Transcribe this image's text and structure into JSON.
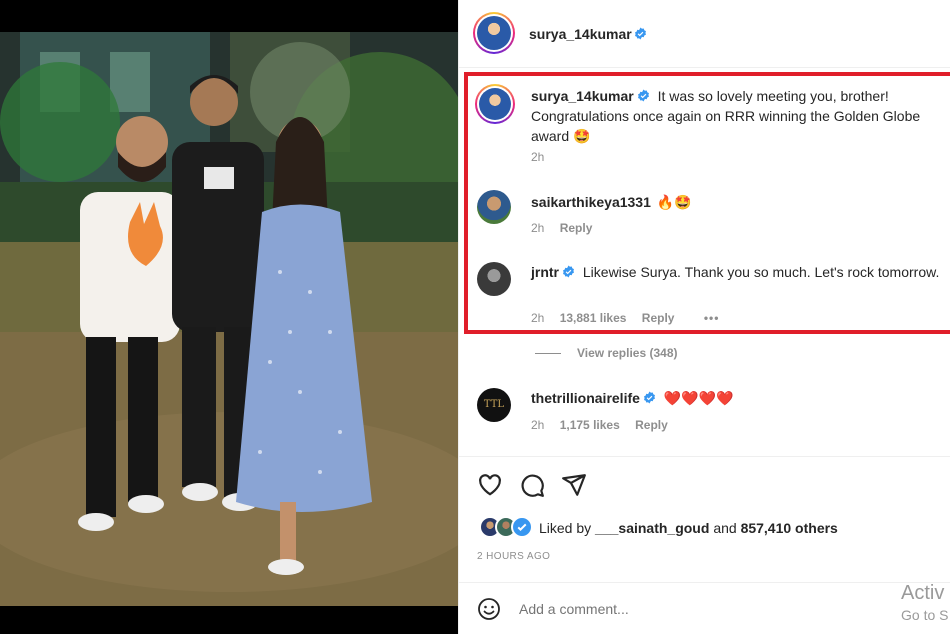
{
  "post_owner": {
    "username": "surya_14kumar",
    "verified": true
  },
  "comments": [
    {
      "username": "surya_14kumar",
      "verified": true,
      "text": "It was so lovely meeting you, brother! Congratulations once again on RRR winning the Golden Globe award 🤩",
      "time": "2h"
    },
    {
      "username": "saikarthikeya1331",
      "verified": false,
      "text": "🔥🤩",
      "time": "2h",
      "reply_label": "Reply"
    },
    {
      "username": "jrntr",
      "verified": true,
      "text": "Likewise Surya. Thank you so much. Let's rock tomorrow.",
      "time": "2h",
      "likes": "13,881 likes",
      "reply_label": "Reply",
      "more_label": "•••"
    },
    {
      "username": "thetrillionairelife",
      "verified": true,
      "text": "❤️❤️❤️❤️",
      "time": "2h",
      "likes": "1,175 likes",
      "reply_label": "Reply",
      "avatar_text": "TTL"
    }
  ],
  "view_replies": "View replies (348)",
  "actions": {
    "like_icon": "heart-icon",
    "comment_icon": "comment-icon",
    "share_icon": "share-icon"
  },
  "likes_summary": {
    "prefix": "Liked by",
    "user": "___sainath_goud",
    "joiner": "and",
    "others": "857,410 others"
  },
  "time_ago": "2 HOURS AGO",
  "add_comment": {
    "placeholder": "Add a comment...",
    "emoji_icon": "smiley-icon"
  },
  "watermark": {
    "line1": "Activ",
    "line2": "Go to S"
  },
  "colors": {
    "highlight": "#e01e2a",
    "verified": "#3897f0",
    "muted": "#8e8e8e"
  }
}
